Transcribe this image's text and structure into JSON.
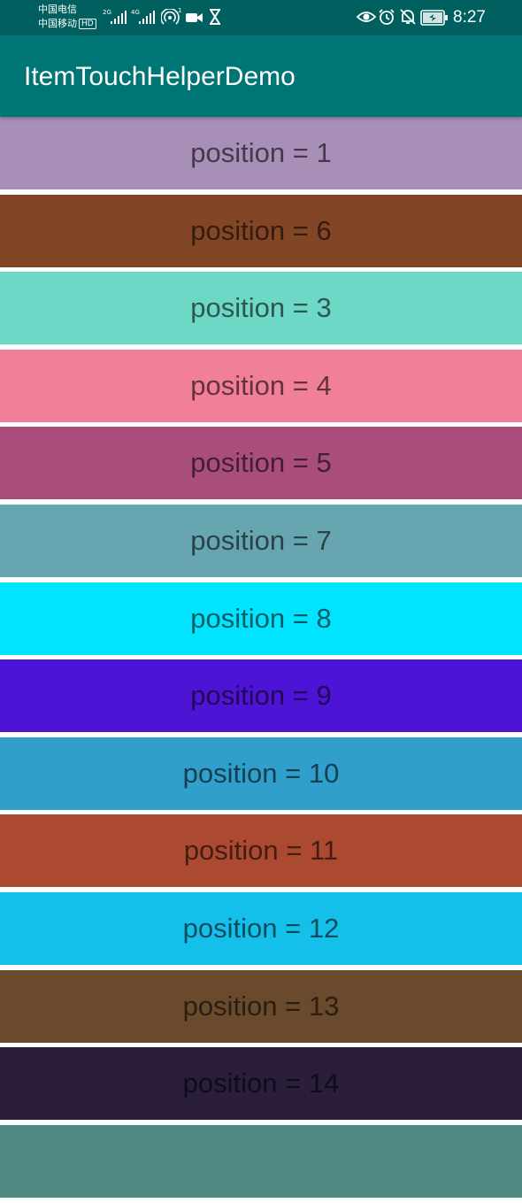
{
  "status_bar": {
    "carrier_1": "中国电信",
    "carrier_2": "中国移动",
    "hd_badge": "HD",
    "network_1": "2G",
    "network_2": "4G",
    "hotspot_count": "1",
    "time": "8:27",
    "icons": [
      "signal-icon",
      "hotspot-icon",
      "video-camera-icon",
      "hourglass-icon",
      "eye-icon",
      "alarm-icon",
      "notifications-off-icon",
      "battery-icon"
    ]
  },
  "app_bar": {
    "title": "ItemTouchHelperDemo",
    "color": "#007575"
  },
  "list": {
    "items": [
      {
        "label": "position = 1",
        "color": "#a78fb8"
      },
      {
        "label": "position = 6",
        "color": "#824627"
      },
      {
        "label": "position = 3",
        "color": "#6ed8c6"
      },
      {
        "label": "position = 4",
        "color": "#f27f98"
      },
      {
        "label": "position = 5",
        "color": "#a94e7c"
      },
      {
        "label": "position = 7",
        "color": "#67a5b1"
      },
      {
        "label": "position = 8",
        "color": "#00e4ff"
      },
      {
        "label": "position = 9",
        "color": "#4e14d6"
      },
      {
        "label": "position = 10",
        "color": "#309fcb"
      },
      {
        "label": "position = 11",
        "color": "#ab4931"
      },
      {
        "label": "position = 12",
        "color": "#14c0e9"
      },
      {
        "label": "position = 13",
        "color": "#6a4a2c"
      },
      {
        "label": "position = 14",
        "color": "#2a1e3a"
      },
      {
        "label": "",
        "color": "#4f8a83"
      }
    ]
  }
}
